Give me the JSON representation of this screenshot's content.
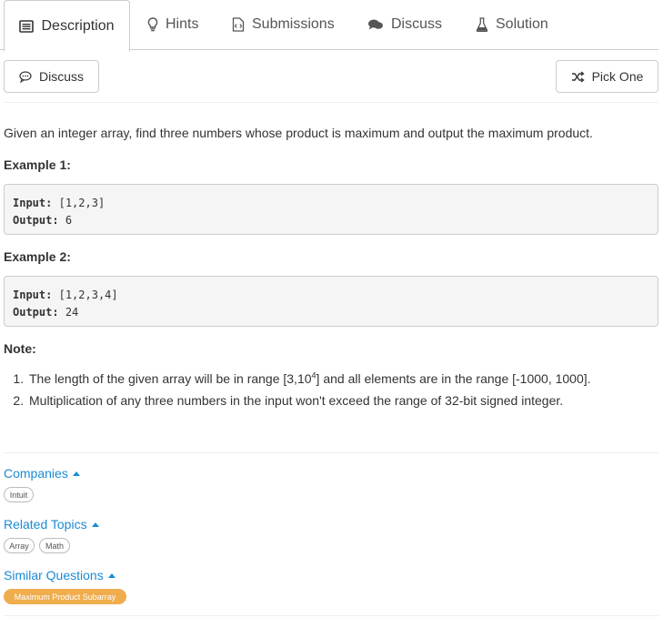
{
  "tabs": [
    {
      "label": "Description",
      "icon": "description-icon"
    },
    {
      "label": "Hints",
      "icon": "lightbulb-icon"
    },
    {
      "label": "Submissions",
      "icon": "code-file-icon"
    },
    {
      "label": "Discuss",
      "icon": "comments-icon"
    },
    {
      "label": "Solution",
      "icon": "flask-icon"
    }
  ],
  "toolbar": {
    "discuss_label": "Discuss",
    "pick_one_label": "Pick One"
  },
  "problem": {
    "statement": "Given an integer array, find three numbers whose product is maximum and output the maximum product.",
    "examples": [
      {
        "heading": "Example 1:",
        "input_label": "Input:",
        "input": "[1,2,3]",
        "output_label": "Output:",
        "output": "6"
      },
      {
        "heading": "Example 2:",
        "input_label": "Input:",
        "input": "[1,2,3,4]",
        "output_label": "Output:",
        "output": "24"
      }
    ],
    "note_heading": "Note:",
    "notes": [
      {
        "pre": "The length of the given array will be in range [3,10",
        "sup": "4",
        "post": "] and all elements are in the range [-1000, 1000]."
      },
      {
        "text": "Multiplication of any three numbers in the input won't exceed the range of 32-bit signed integer."
      }
    ]
  },
  "companies": {
    "label": "Companies",
    "tags": [
      "Intuit"
    ]
  },
  "related_topics": {
    "label": "Related Topics",
    "tags": [
      "Array",
      "Math"
    ]
  },
  "similar_questions": {
    "label": "Similar Questions",
    "tags": [
      "Maximum Product Subarray"
    ]
  },
  "colors": {
    "link": "#1a8bd3",
    "similar_tag": "#f0ad4e"
  }
}
